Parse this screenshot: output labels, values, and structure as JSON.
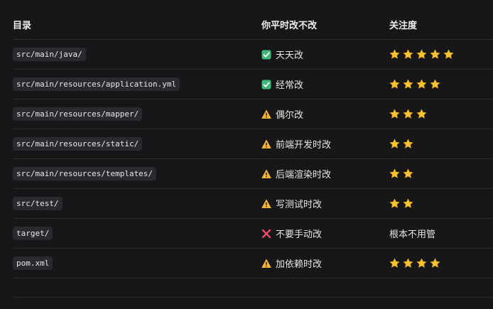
{
  "headers": {
    "directory": "目录",
    "change_frequency": "你平时改不改",
    "attention": "关注度"
  },
  "rows": [
    {
      "path": "src/main/java/",
      "status_icon": "check-icon",
      "frequency": "天天改",
      "stars": 5,
      "attention_text": ""
    },
    {
      "path": "src/main/resources/application.yml",
      "status_icon": "check-icon",
      "frequency": "经常改",
      "stars": 4,
      "attention_text": ""
    },
    {
      "path": "src/main/resources/mapper/",
      "status_icon": "warning-icon",
      "frequency": "偶尔改",
      "stars": 3,
      "attention_text": ""
    },
    {
      "path": "src/main/resources/static/",
      "status_icon": "warning-icon",
      "frequency": "前端开发时改",
      "stars": 2,
      "attention_text": ""
    },
    {
      "path": "src/main/resources/templates/",
      "status_icon": "warning-icon",
      "frequency": "后端渲染时改",
      "stars": 2,
      "attention_text": ""
    },
    {
      "path": "src/test/",
      "status_icon": "warning-icon",
      "frequency": "写测试时改",
      "stars": 2,
      "attention_text": ""
    },
    {
      "path": "target/",
      "status_icon": "cross-icon",
      "frequency": "不要手动改",
      "stars": 0,
      "attention_text": "根本不用管"
    },
    {
      "path": "pom.xml",
      "status_icon": "warning-icon",
      "frequency": "加依赖时改",
      "stars": 4,
      "attention_text": ""
    }
  ],
  "colors": {
    "check": "#3fb879",
    "warning": "#f5b43b",
    "cross": "#ee4b6a",
    "star": "#f7c334"
  }
}
